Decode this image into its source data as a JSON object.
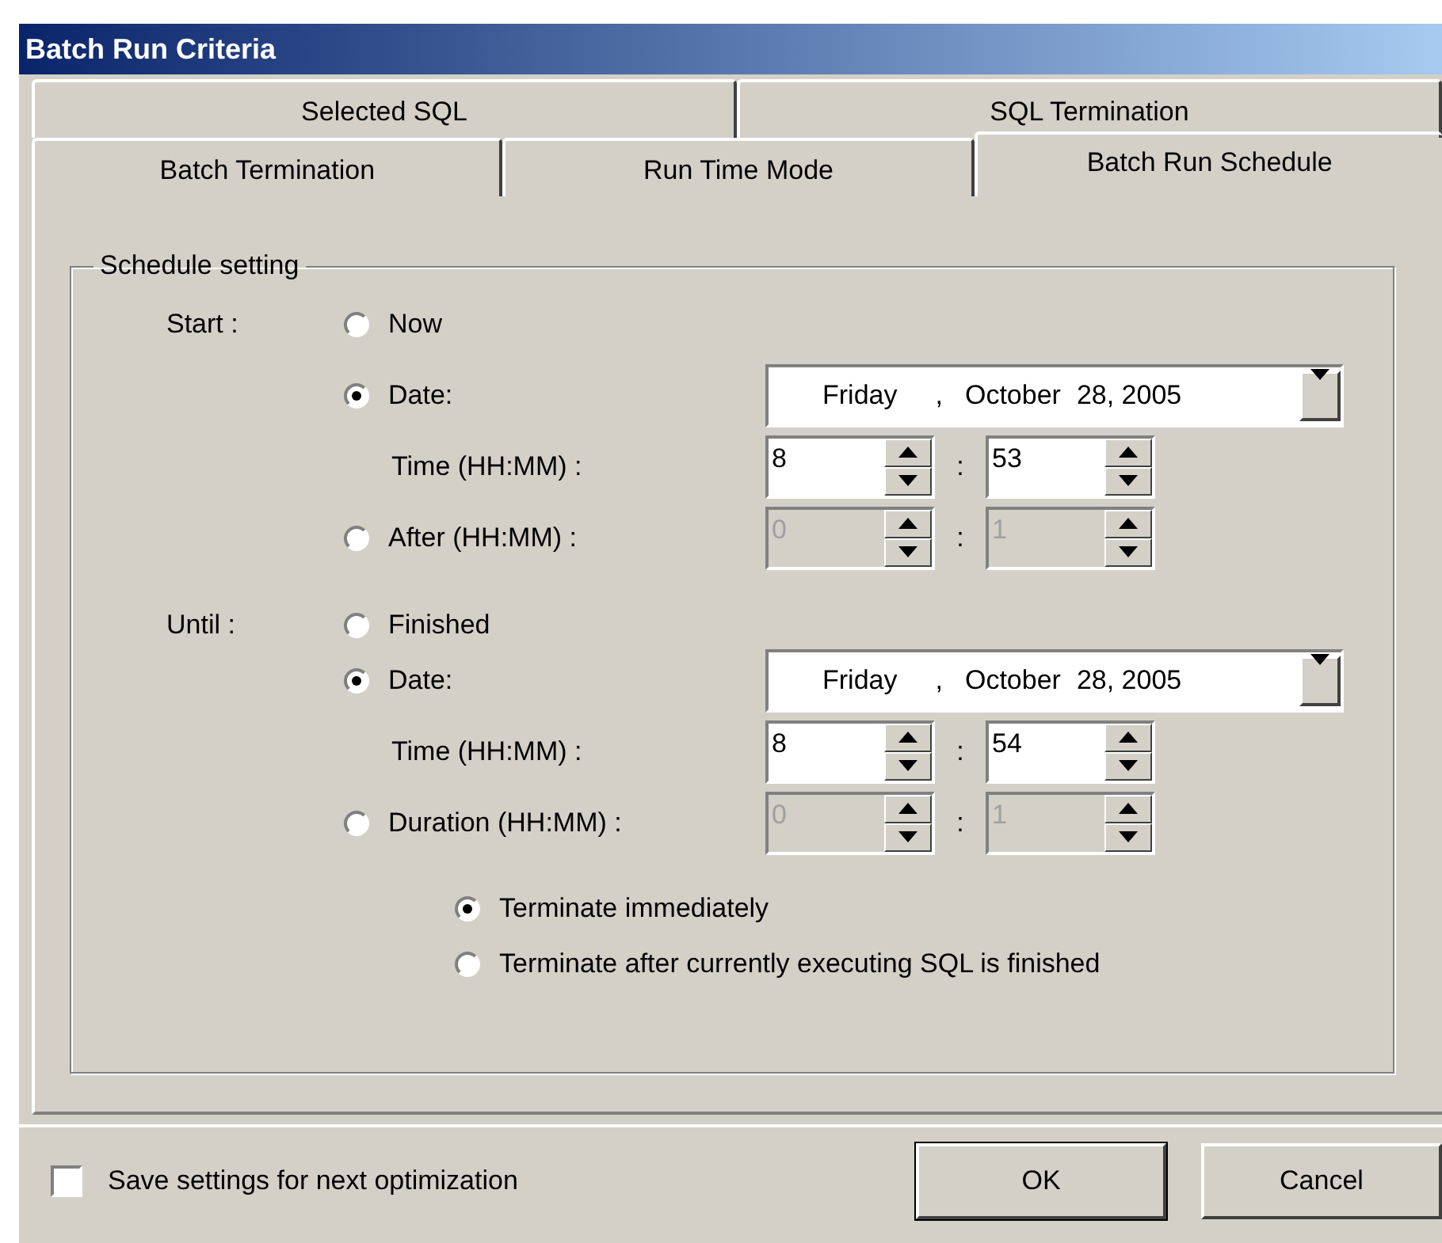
{
  "window": {
    "title": "Batch Run Criteria"
  },
  "tab_rows": [
    {
      "tabs": [
        {
          "label": "Selected SQL",
          "selected": false
        },
        {
          "label": "SQL Termination",
          "selected": false
        }
      ]
    },
    {
      "tabs": [
        {
          "label": "Batch Termination",
          "selected": false
        },
        {
          "label": "Run Time Mode",
          "selected": false
        },
        {
          "label": "Batch Run Schedule",
          "selected": true
        }
      ]
    }
  ],
  "schedule": {
    "title": "Schedule setting",
    "sections": [
      {
        "label": "Start :",
        "rows": [
          {
            "kind": "radio",
            "label": "Now",
            "selected": false
          },
          {
            "kind": "radio",
            "label": "Date:",
            "selected": true,
            "date": {
              "weekday": "Friday",
              "separator": ",",
              "month": "October",
              "day_year": "28, 2005"
            }
          },
          {
            "kind": "time",
            "label": "Time (HH:MM) :",
            "time": {
              "hours": "8",
              "separator": ":",
              "minutes": "53",
              "disabled": false
            }
          },
          {
            "kind": "radio",
            "label": "After (HH:MM) :",
            "selected": false,
            "time": {
              "hours": "0",
              "separator": ":",
              "minutes": "1",
              "disabled": true
            }
          }
        ]
      },
      {
        "label": "Until :",
        "rows": [
          {
            "kind": "radio",
            "label": "Finished",
            "selected": false
          },
          {
            "kind": "radio",
            "label": "Date:",
            "selected": true,
            "date": {
              "weekday": "Friday",
              "separator": ",",
              "month": "October",
              "day_year": "28, 2005"
            }
          },
          {
            "kind": "time",
            "label": "Time (HH:MM) :",
            "time": {
              "hours": "8",
              "separator": ":",
              "minutes": "54",
              "disabled": false
            }
          },
          {
            "kind": "radio",
            "label": "Duration (HH:MM) :",
            "selected": false,
            "time": {
              "hours": "0",
              "separator": ":",
              "minutes": "1",
              "disabled": true
            }
          }
        ]
      }
    ],
    "termination": [
      {
        "label": "Terminate immediately",
        "selected": true
      },
      {
        "label": "Terminate after currently executing SQL is finished",
        "selected": false
      }
    ]
  },
  "save_setting": {
    "label": "Save settings for next optimization",
    "checked": false
  },
  "buttons": [
    {
      "label": "OK",
      "default": true
    },
    {
      "label": "Cancel",
      "default": false
    }
  ]
}
